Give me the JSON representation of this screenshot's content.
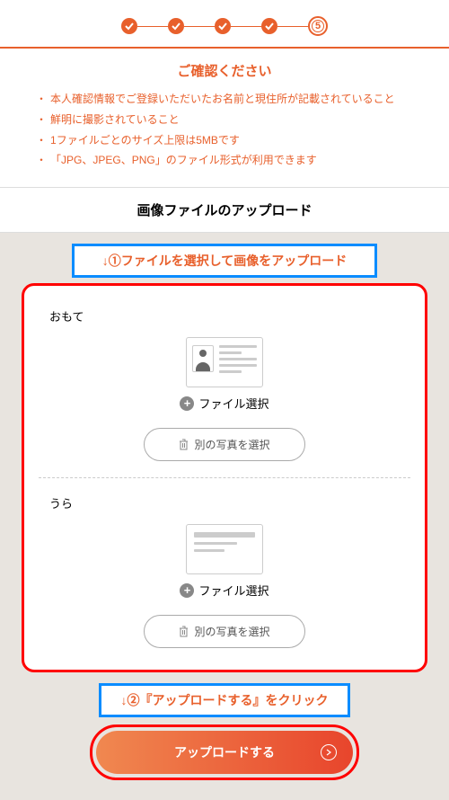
{
  "stepper": {
    "current_step_number": "5"
  },
  "confirm": {
    "title": "ご確認ください",
    "bullets": [
      "本人確認情報でご登録いただいたお名前と現住所が記載されていること",
      "鮮明に撮影されていること",
      "1ファイルごとのサイズ上限は5MBです",
      "「JPG、JPEG、PNG」のファイル形式が利用できます"
    ]
  },
  "upload_section": {
    "title": "画像ファイルのアップロード",
    "instruction1": "↓①ファイルを選択して画像をアップロード",
    "front": {
      "label": "おもて",
      "file_select": "ファイル選択",
      "alt_button": "別の写真を選択"
    },
    "back": {
      "label": "うら",
      "file_select": "ファイル選択",
      "alt_button": "別の写真を選択"
    },
    "instruction2": "↓②『アップロードする』をクリック",
    "submit_button": "アップロードする"
  }
}
